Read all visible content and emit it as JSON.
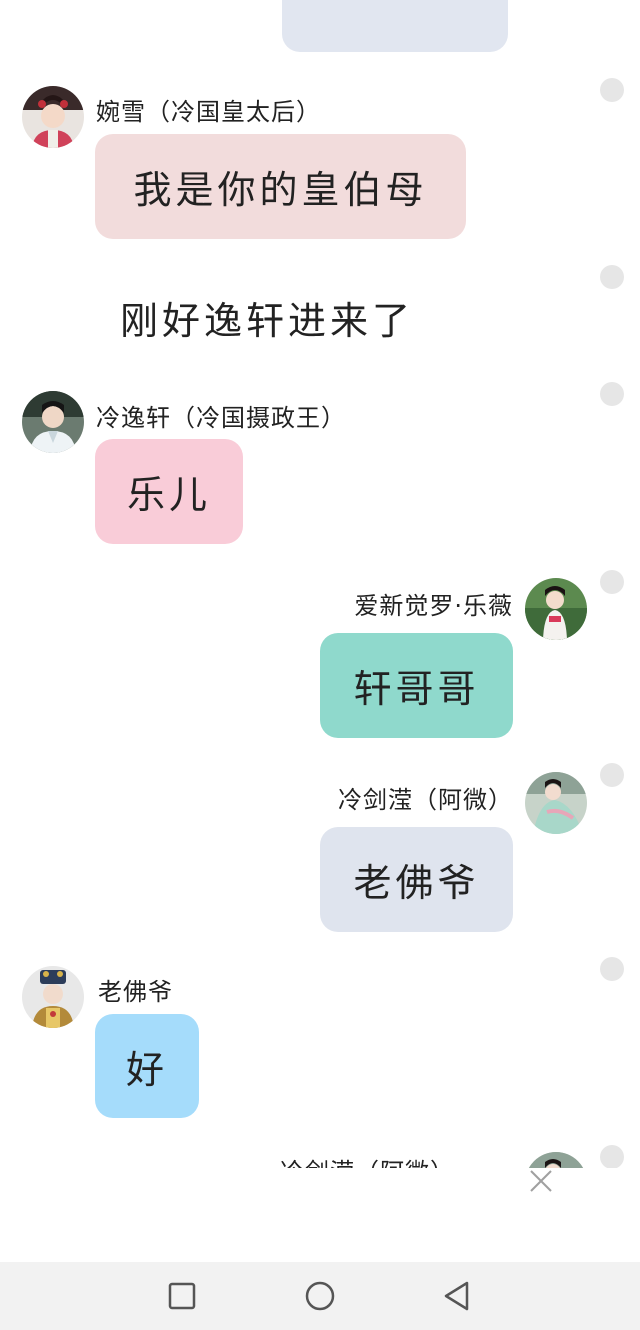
{
  "messages": [
    {
      "sender": "婉雪（冷国皇太后）",
      "text": "我是你的皇伯母",
      "side": "left",
      "bubble_color": "#f2dcdc"
    },
    {
      "narration": "刚好逸轩进来了"
    },
    {
      "sender": "冷逸轩（冷国摄政王）",
      "text": "乐儿",
      "side": "left",
      "bubble_color": "#f9ccd8"
    },
    {
      "sender": "爱新觉罗·乐薇",
      "text": "轩哥哥",
      "side": "right",
      "bubble_color": "#8fd9cc"
    },
    {
      "sender": "冷剑滢（阿微）",
      "text": "老佛爷",
      "side": "right",
      "bubble_color": "#dfe4ee"
    },
    {
      "sender": "老佛爷",
      "text": "好",
      "side": "left",
      "bubble_color": "#a5dcfb"
    }
  ],
  "peek_sender": "冷剑滢（阿微）",
  "avatars": [
    "avatar-wanxue-icon",
    "avatar-yixuan-icon",
    "avatar-lewei-icon",
    "avatar-jianying-icon",
    "avatar-laofoye-icon",
    "avatar-jianying-icon"
  ],
  "icons": {
    "close": "close-icon",
    "nav_recent": "square-recent-apps-icon",
    "nav_home": "circle-home-icon",
    "nav_back": "triangle-back-icon"
  },
  "colors": {
    "radio": "#e6e6e6",
    "navbar": "#f2f2f2"
  }
}
